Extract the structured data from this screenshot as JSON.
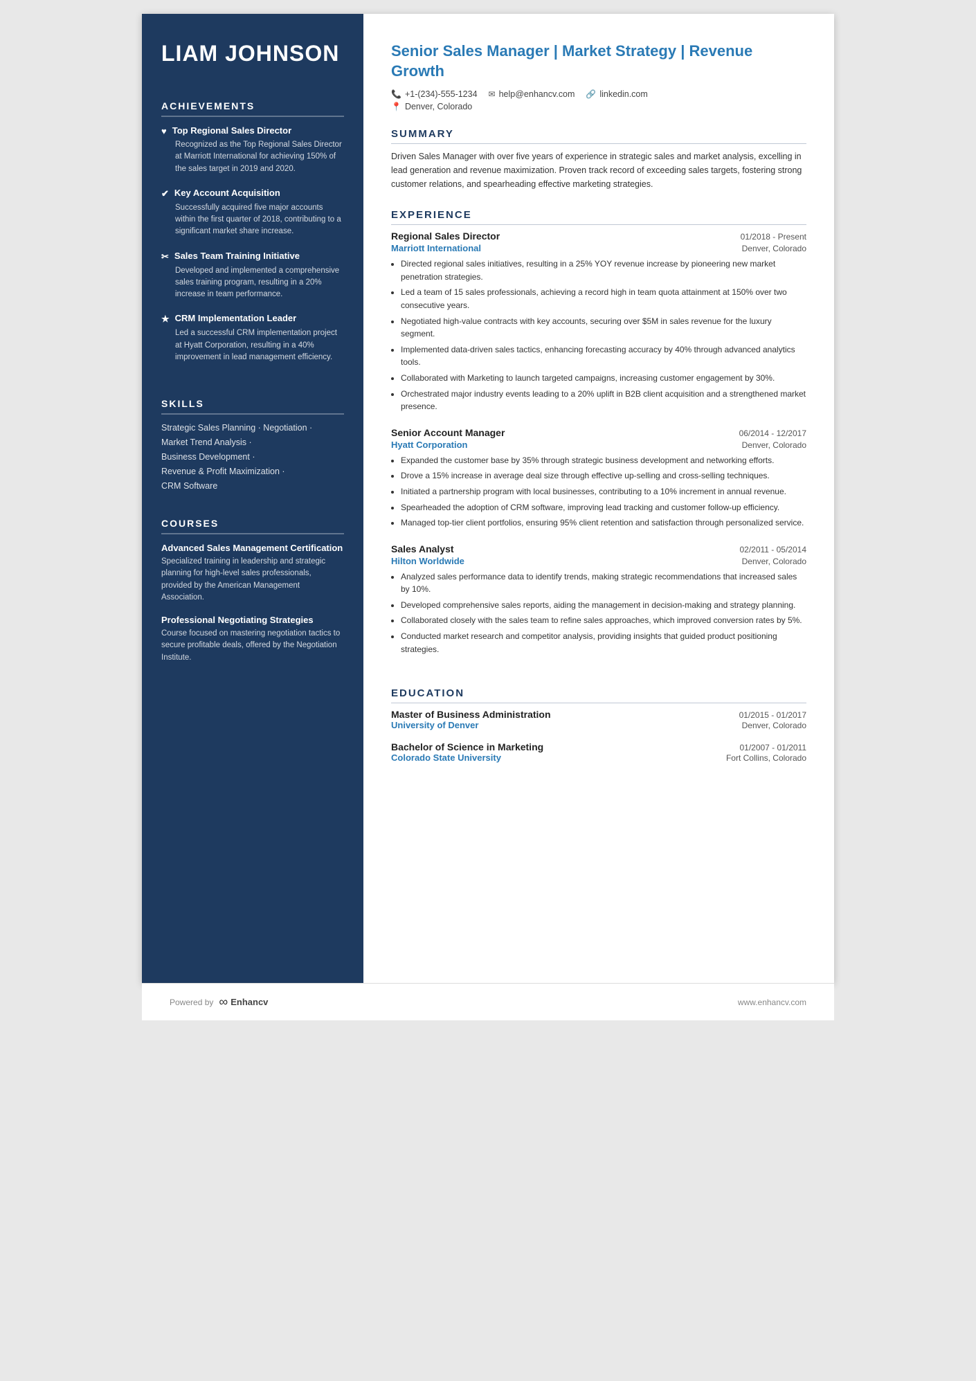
{
  "sidebar": {
    "name": "LIAM JOHNSON",
    "achievements_title": "ACHIEVEMENTS",
    "achievements": [
      {
        "icon": "♥",
        "title": "Top Regional Sales Director",
        "desc": "Recognized as the Top Regional Sales Director at Marriott International for achieving 150% of the sales target in 2019 and 2020."
      },
      {
        "icon": "✔",
        "title": "Key Account Acquisition",
        "desc": "Successfully acquired five major accounts within the first quarter of 2018, contributing to a significant market share increase."
      },
      {
        "icon": "✂",
        "title": "Sales Team Training Initiative",
        "desc": "Developed and implemented a comprehensive sales training program, resulting in a 20% increase in team performance."
      },
      {
        "icon": "★",
        "title": "CRM Implementation Leader",
        "desc": "Led a successful CRM implementation project at Hyatt Corporation, resulting in a 40% improvement in lead management efficiency."
      }
    ],
    "skills_title": "SKILLS",
    "skills": [
      "Strategic Sales Planning · Negotiation ·",
      "Market Trend Analysis ·",
      "Business Development ·",
      "Revenue & Profit Maximization ·",
      "CRM Software"
    ],
    "courses_title": "COURSES",
    "courses": [
      {
        "title": "Advanced Sales Management Certification",
        "desc": "Specialized training in leadership and strategic planning for high-level sales professionals, provided by the American Management Association."
      },
      {
        "title": "Professional Negotiating Strategies",
        "desc": "Course focused on mastering negotiation tactics to secure profitable deals, offered by the Negotiation Institute."
      }
    ]
  },
  "main": {
    "title": "Senior Sales Manager | Market Strategy | Revenue Growth",
    "contact": {
      "phone": "+1-(234)-555-1234",
      "email": "help@enhancv.com",
      "linkedin": "linkedin.com",
      "location": "Denver, Colorado"
    },
    "summary_title": "SUMMARY",
    "summary": "Driven Sales Manager with over five years of experience in strategic sales and market analysis, excelling in lead generation and revenue maximization. Proven track record of exceeding sales targets, fostering strong customer relations, and spearheading effective marketing strategies.",
    "experience_title": "EXPERIENCE",
    "experience": [
      {
        "role": "Regional Sales Director",
        "dates": "01/2018 - Present",
        "company": "Marriott International",
        "location": "Denver, Colorado",
        "bullets": [
          "Directed regional sales initiatives, resulting in a 25% YOY revenue increase by pioneering new market penetration strategies.",
          "Led a team of 15 sales professionals, achieving a record high in team quota attainment at 150% over two consecutive years.",
          "Negotiated high-value contracts with key accounts, securing over $5M in sales revenue for the luxury segment.",
          "Implemented data-driven sales tactics, enhancing forecasting accuracy by 40% through advanced analytics tools.",
          "Collaborated with Marketing to launch targeted campaigns, increasing customer engagement by 30%.",
          "Orchestrated major industry events leading to a 20% uplift in B2B client acquisition and a strengthened market presence."
        ]
      },
      {
        "role": "Senior Account Manager",
        "dates": "06/2014 - 12/2017",
        "company": "Hyatt Corporation",
        "location": "Denver, Colorado",
        "bullets": [
          "Expanded the customer base by 35% through strategic business development and networking efforts.",
          "Drove a 15% increase in average deal size through effective up-selling and cross-selling techniques.",
          "Initiated a partnership program with local businesses, contributing to a 10% increment in annual revenue.",
          "Spearheaded the adoption of CRM software, improving lead tracking and customer follow-up efficiency.",
          "Managed top-tier client portfolios, ensuring 95% client retention and satisfaction through personalized service."
        ]
      },
      {
        "role": "Sales Analyst",
        "dates": "02/2011 - 05/2014",
        "company": "Hilton Worldwide",
        "location": "Denver, Colorado",
        "bullets": [
          "Analyzed sales performance data to identify trends, making strategic recommendations that increased sales by 10%.",
          "Developed comprehensive sales reports, aiding the management in decision-making and strategy planning.",
          "Collaborated closely with the sales team to refine sales approaches, which improved conversion rates by 5%.",
          "Conducted market research and competitor analysis, providing insights that guided product positioning strategies."
        ]
      }
    ],
    "education_title": "EDUCATION",
    "education": [
      {
        "degree": "Master of Business Administration",
        "dates": "01/2015 - 01/2017",
        "school": "University of Denver",
        "location": "Denver, Colorado"
      },
      {
        "degree": "Bachelor of Science in Marketing",
        "dates": "01/2007 - 01/2011",
        "school": "Colorado State University",
        "location": "Fort Collins, Colorado"
      }
    ]
  },
  "footer": {
    "powered_by": "Powered by",
    "brand": "Enhancv",
    "website": "www.enhancv.com"
  }
}
